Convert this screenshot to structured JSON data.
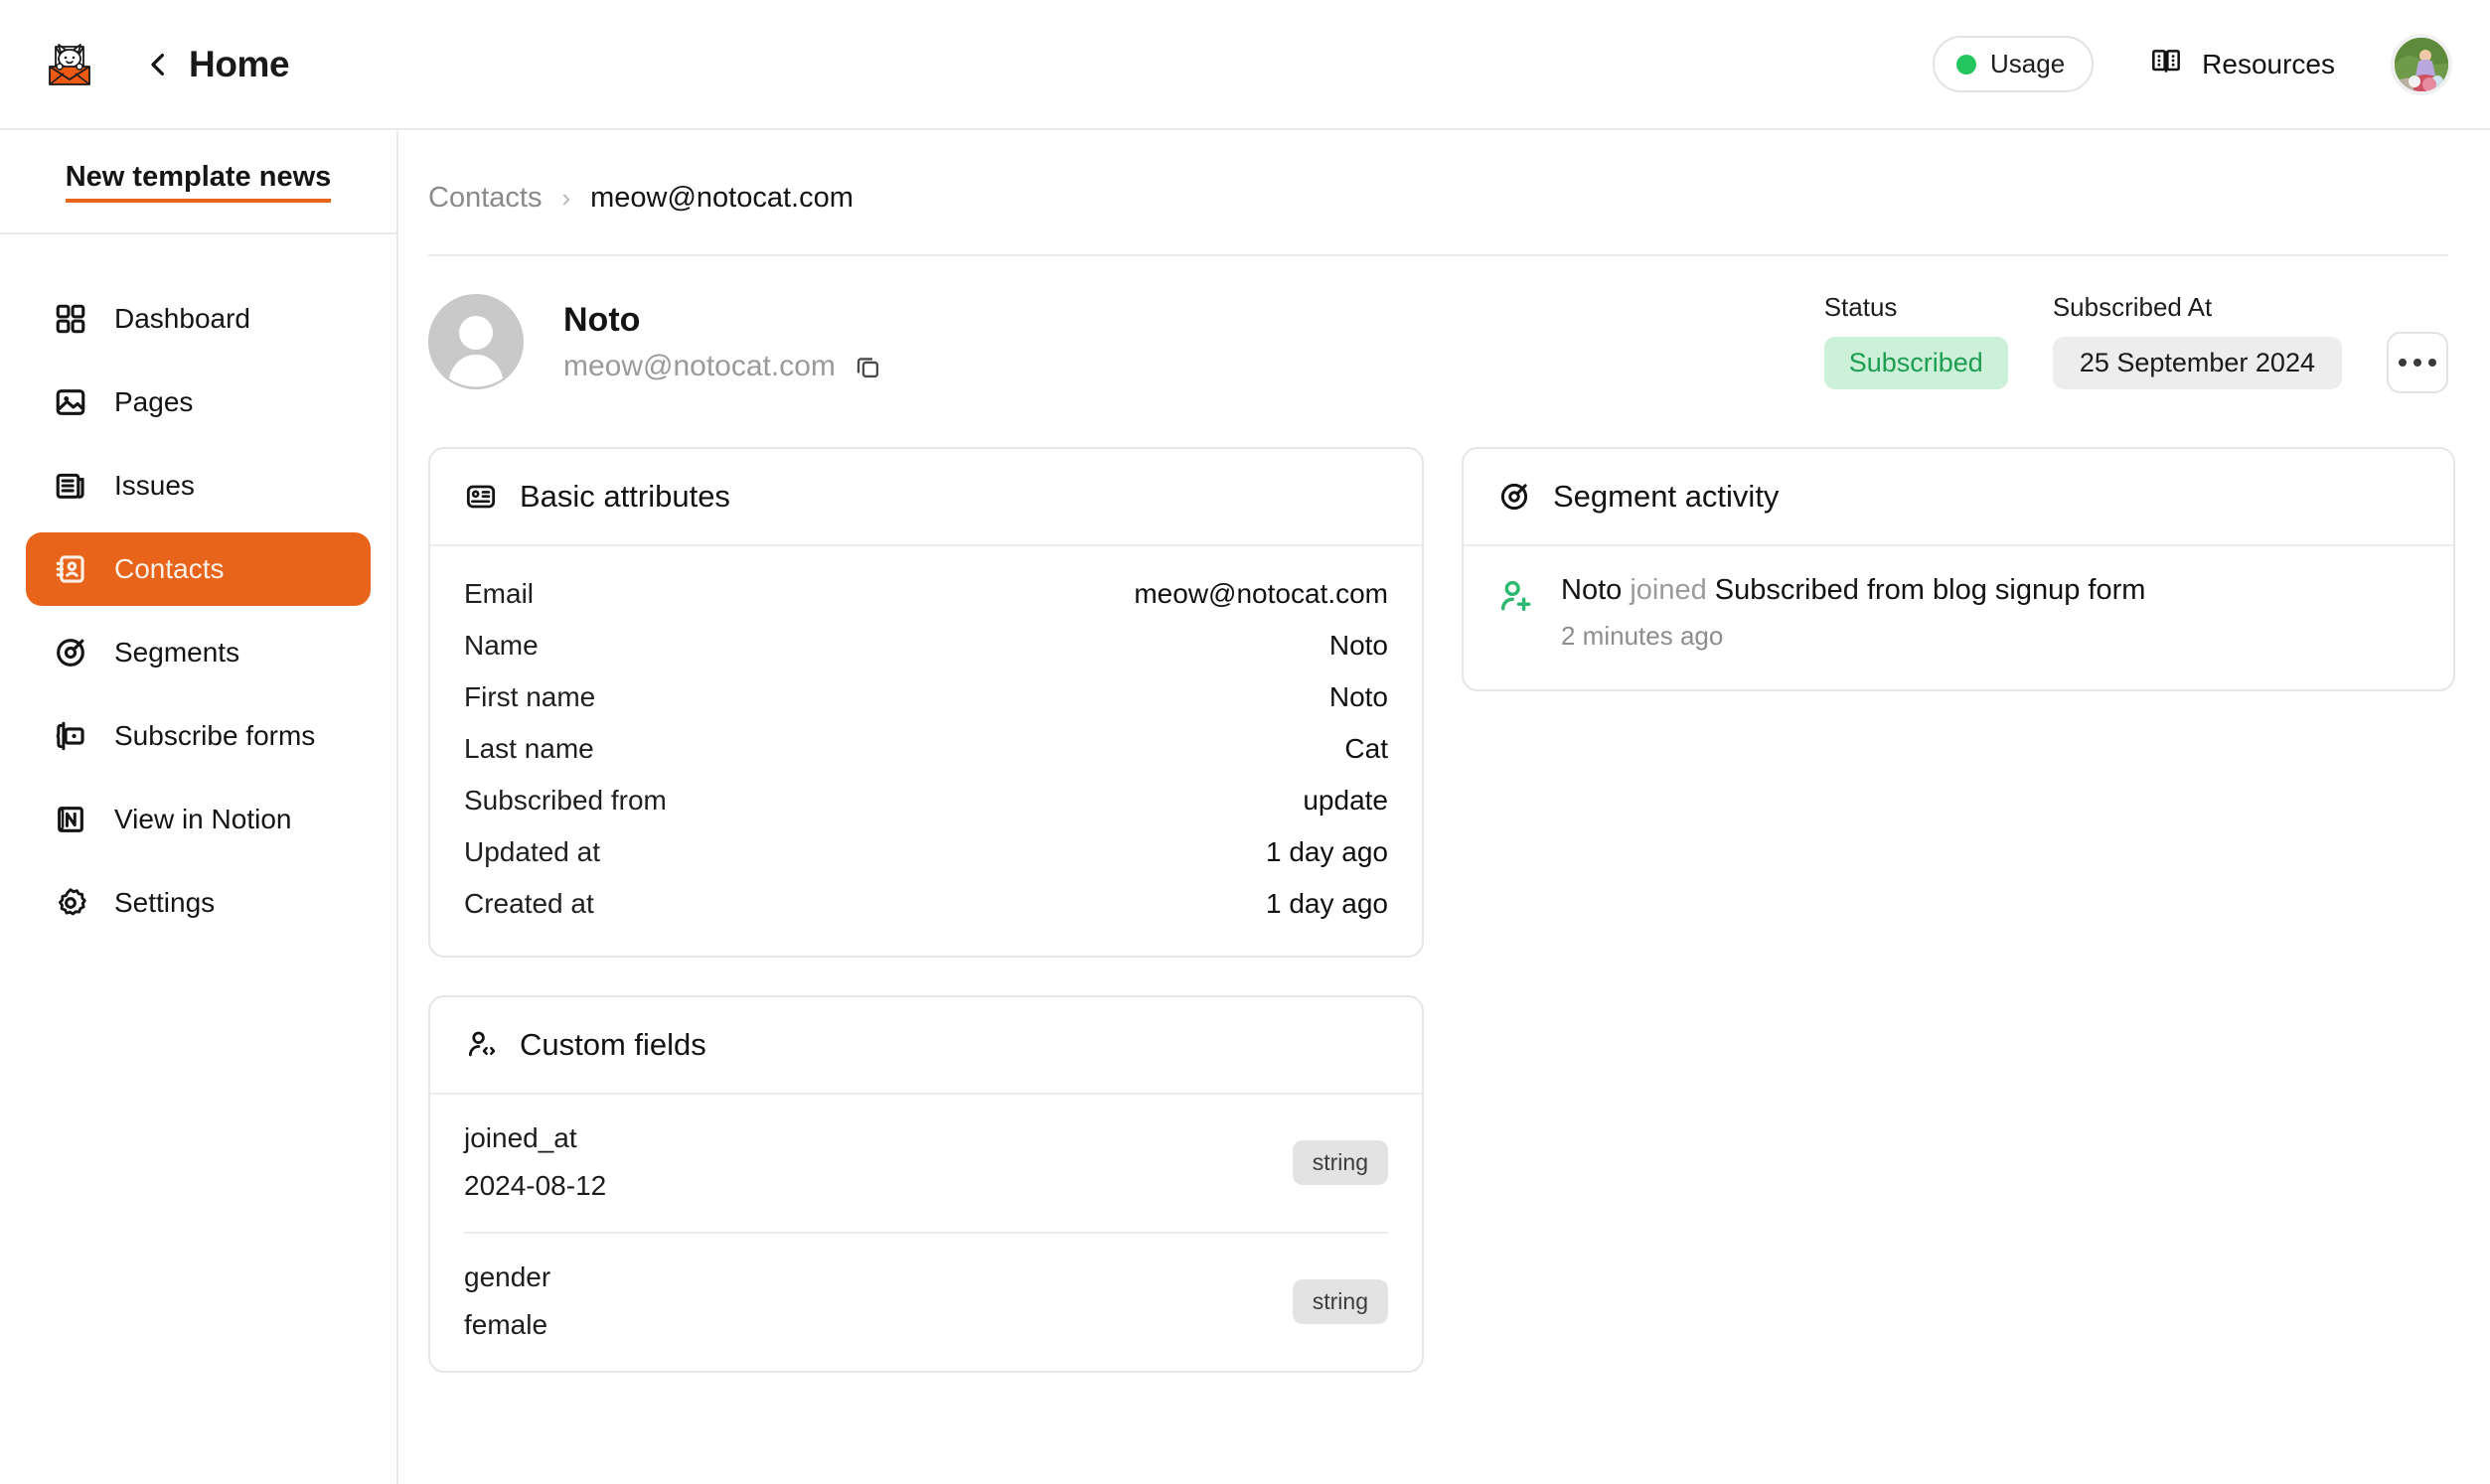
{
  "topbar": {
    "logo_icon": "cat-envelope-logo",
    "back_icon": "chevron-left-icon",
    "home_label": "Home",
    "usage_label": "Usage",
    "usage_dot_color": "#22c55e",
    "resources_label": "Resources",
    "resources_icon": "book-icon",
    "avatar_icon": "user-avatar-photo"
  },
  "sidebar": {
    "newsletter_name": "New template news",
    "accent_color": "#e8641a",
    "items": [
      {
        "label": "Dashboard",
        "icon": "grid-icon",
        "active": false
      },
      {
        "label": "Pages",
        "icon": "image-icon",
        "active": false
      },
      {
        "label": "Issues",
        "icon": "newspaper-icon",
        "active": false
      },
      {
        "label": "Contacts",
        "icon": "contact-book-icon",
        "active": true
      },
      {
        "label": "Segments",
        "icon": "target-icon",
        "active": false
      },
      {
        "label": "Subscribe forms",
        "icon": "form-icon",
        "active": false
      },
      {
        "label": "View in Notion",
        "icon": "notion-icon",
        "active": false
      },
      {
        "label": "Settings",
        "icon": "gear-icon",
        "active": false
      }
    ]
  },
  "breadcrumb": {
    "parent": "Contacts",
    "separator": "›",
    "current": "meow@notocat.com"
  },
  "contact": {
    "avatar_icon": "person-placeholder-avatar",
    "name": "Noto",
    "email": "meow@notocat.com",
    "copy_icon": "copy-icon",
    "status_label": "Status",
    "status_value": "Subscribed",
    "status_color": "#1d9d52",
    "status_bg": "#ccf0d8",
    "subscribed_at_label": "Subscribed At",
    "subscribed_at_value": "25 September 2024",
    "more_icon": "ellipsis-icon"
  },
  "basic_attributes": {
    "title": "Basic attributes",
    "icon": "id-card-icon",
    "rows": [
      {
        "key": "Email",
        "value": "meow@notocat.com"
      },
      {
        "key": "Name",
        "value": "Noto"
      },
      {
        "key": "First name",
        "value": "Noto"
      },
      {
        "key": "Last name",
        "value": "Cat"
      },
      {
        "key": "Subscribed from",
        "value": "update"
      },
      {
        "key": "Updated at",
        "value": "1 day ago"
      },
      {
        "key": "Created at",
        "value": "1 day ago"
      }
    ]
  },
  "custom_fields": {
    "title": "Custom fields",
    "icon": "person-code-icon",
    "rows": [
      {
        "key": "joined_at",
        "value": "2024-08-12",
        "type": "string"
      },
      {
        "key": "gender",
        "value": "female",
        "type": "string"
      }
    ]
  },
  "segment_activity": {
    "title": "Segment activity",
    "icon": "target-icon",
    "entries": [
      {
        "icon": "person-plus-icon",
        "icon_color": "#2eb872",
        "actor": "Noto",
        "verb": "joined",
        "segment": "Subscribed from blog signup form",
        "time": "2 minutes ago"
      }
    ]
  }
}
